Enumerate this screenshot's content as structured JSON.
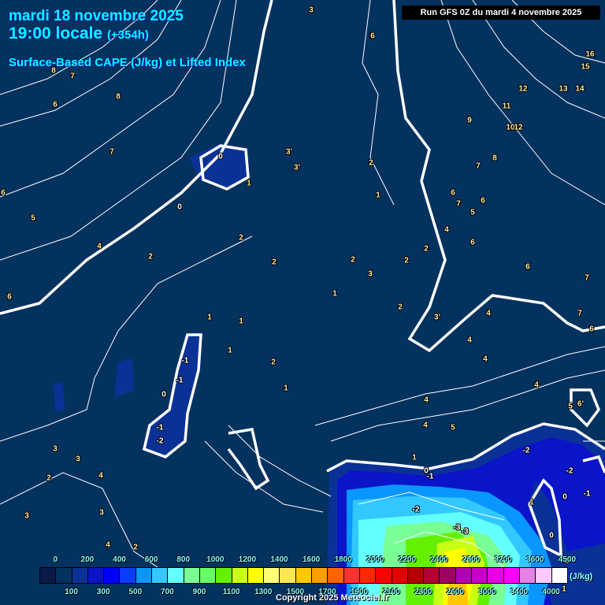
{
  "header": {
    "date": "mardi 18 novembre 2025",
    "time": "19:00 locale",
    "offset": "(+354h)",
    "parameter": "Surface-Based CAPE (J/kg) et Lifted Index",
    "run": "Run GFS 0Z du mardi 4 novembre 2025"
  },
  "contour_labels": [
    "3",
    "6",
    "8",
    "7",
    "8",
    "6",
    "7",
    "6",
    "5",
    "4",
    "6",
    "0",
    "0",
    "1",
    "3'",
    "3'",
    "2",
    "1",
    "2",
    "2",
    "2",
    "2",
    "3",
    "2",
    "2",
    "1",
    "2",
    "1",
    "1",
    "1",
    "2",
    "1",
    "-1",
    "-1",
    "0",
    "-1",
    "-2",
    "3",
    "3",
    "2",
    "4",
    "3",
    "3",
    "4",
    "2",
    "6",
    "9",
    "12",
    "11",
    "13",
    "14",
    "15",
    "16",
    "10",
    "12",
    "7",
    "8",
    "6",
    "7",
    "6",
    "5",
    "4",
    "6",
    "6",
    "4",
    "4",
    "3'",
    "4",
    "7",
    "7",
    "6",
    "4",
    "4",
    "5",
    "6'",
    "5",
    "4",
    "1",
    "0",
    "-1",
    "-2",
    "-2",
    "-2",
    "-1",
    "0",
    "-3",
    "-3",
    "1",
    "0",
    "1",
    "2"
  ],
  "legend": {
    "unit": "(J/kg)",
    "top_labels": [
      "0",
      "200",
      "400",
      "600",
      "800",
      "1000",
      "1200",
      "1400",
      "1600",
      "1800",
      "2000",
      "2200",
      "2400",
      "2800",
      "3200",
      "3600",
      "4500"
    ],
    "bottom_labels": [
      "100",
      "300",
      "500",
      "700",
      "900",
      "1100",
      "1300",
      "1500",
      "1700",
      "1900",
      "2100",
      "2300",
      "2600",
      "3000",
      "3400",
      "4000"
    ],
    "colors": [
      "#0a1a48",
      "#04325f",
      "#0a3296",
      "#0a14c8",
      "#0000ff",
      "#0a3cff",
      "#0a96ff",
      "#32c8ff",
      "#64ffff",
      "#78ff96",
      "#64ff64",
      "#64f000",
      "#c8ff14",
      "#ffff00",
      "#ffff78",
      "#ffe650",
      "#ffc800",
      "#ffa000",
      "#ff6400",
      "#ff3232",
      "#ff2800",
      "#ff0000",
      "#e60000",
      "#b40000",
      "#b40032",
      "#a00064",
      "#b400b4",
      "#c800c8",
      "#e600e6",
      "#ff00ff",
      "#e682e6",
      "#ffc8ff",
      "#ffffff"
    ]
  },
  "copyright": "Copyright 2025 Meteociel.fr"
}
